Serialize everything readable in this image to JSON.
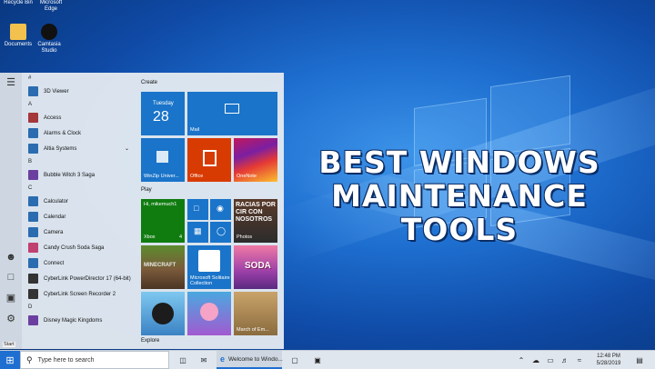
{
  "headline": {
    "line1": "BEST WINDOWS",
    "line2": "MAINTENANCE",
    "line3": "TOOLS"
  },
  "desktop_icons": [
    {
      "label": "Recycle Bin"
    },
    {
      "label": "Microsoft Edge"
    },
    {
      "label": "Documents"
    },
    {
      "label": "Camtasia Studio"
    }
  ],
  "start_menu": {
    "apps": [
      {
        "letter": "#"
      },
      {
        "label": "3D Viewer",
        "color": "#2b6cb0"
      },
      {
        "letter": "A"
      },
      {
        "label": "Access",
        "color": "#a4373a"
      },
      {
        "label": "Alarms & Clock",
        "color": "#2b6cb0"
      },
      {
        "label": "Altia Systems",
        "color": "#2b6cb0",
        "expand": true
      },
      {
        "letter": "B"
      },
      {
        "label": "Bubble Witch 3 Saga",
        "color": "#6b3fa0"
      },
      {
        "letter": "C"
      },
      {
        "label": "Calculator",
        "color": "#2b6cb0"
      },
      {
        "label": "Calendar",
        "color": "#2b6cb0"
      },
      {
        "label": "Camera",
        "color": "#2b6cb0"
      },
      {
        "label": "Candy Crush Soda Saga",
        "color": "#c04070"
      },
      {
        "label": "Connect",
        "color": "#2b6cb0"
      },
      {
        "label": "CyberLink PowerDirector 17 (64-bit)",
        "color": "#333"
      },
      {
        "label": "CyberLink Screen Recorder 2",
        "color": "#333"
      },
      {
        "letter": "D"
      },
      {
        "label": "Disney Magic Kingdoms",
        "color": "#6b3fa0"
      }
    ],
    "groups": {
      "create": "Create",
      "play": "Play",
      "explore": "Explore"
    },
    "tiles": {
      "calendar_day": "Tuesday",
      "calendar_date": "28",
      "mail": "Mail",
      "winzip": "WinZip Univer...",
      "office": "Office",
      "onenote": "OneNote",
      "xbox_greeting": "Hi, mikemuch1",
      "xbox": "Xbox",
      "xbox_count": "4",
      "photos": "Photos",
      "photos_text": "RACIAS POR CIR CON NOSOTROS",
      "solitaire": "Microsoft Solitaire Collection",
      "soda": "SODA",
      "march": "March of Em..."
    },
    "start_tooltip": "Start"
  },
  "taskbar": {
    "search_placeholder": "Type here to search",
    "edge_title": "Welcome to Windo...",
    "time": "12:48 PM",
    "date": "5/28/2019"
  }
}
